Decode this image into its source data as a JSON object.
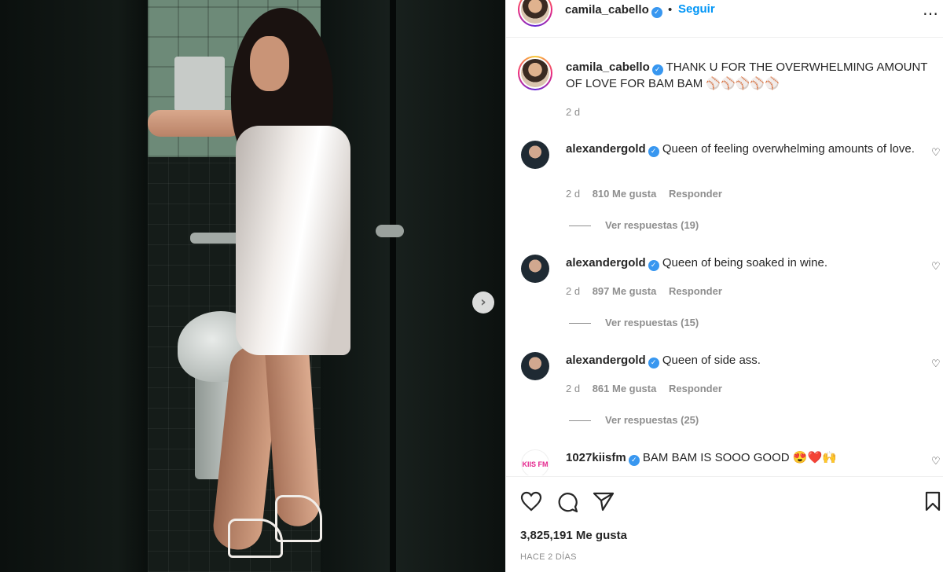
{
  "header": {
    "username": "camila_cabello",
    "verified_mark": "✓",
    "separator": "•",
    "follow_label": "Seguir",
    "more_icon": "…"
  },
  "caption": {
    "username": "camila_cabello",
    "verified_mark": "✓",
    "text": "THANK U FOR THE OVERWHELMING AMOUNT OF LOVE FOR BAM BAM ⚾⚾⚾⚾⚾",
    "time": "2 d"
  },
  "comments": [
    {
      "username": "alexandergold",
      "verified_mark": "✓",
      "text": "Queen of feeling overwhelming amounts of love.",
      "time": "2 d",
      "likes": "810 Me gusta",
      "reply": "Responder",
      "view_replies": "Ver respuestas (19)"
    },
    {
      "username": "alexandergold",
      "verified_mark": "✓",
      "text": "Queen of being soaked in wine.",
      "time": "2 d",
      "likes": "897 Me gusta",
      "reply": "Responder",
      "view_replies": "Ver respuestas (15)"
    },
    {
      "username": "alexandergold",
      "verified_mark": "✓",
      "text": "Queen of side ass.",
      "time": "2 d",
      "likes": "861 Me gusta",
      "reply": "Responder",
      "view_replies": "Ver respuestas (25)"
    },
    {
      "username": "1027kiisfm",
      "verified_mark": "✓",
      "text": "BAM BAM IS SOOO GOOD 😍❤️🙌",
      "avatar_text": "KIIS FM"
    }
  ],
  "actions": {
    "like_icon": "heart-icon",
    "comment_icon": "comment-icon",
    "share_icon": "paper-plane-icon",
    "save_icon": "bookmark-icon"
  },
  "likes_count": "3,825,191 Me gusta",
  "post_date": "HACE 2 DÍAS",
  "media": {
    "next_label": "›"
  },
  "colors": {
    "accent": "#0095f6",
    "verified": "#3897f0",
    "muted": "#8e8e8e"
  }
}
